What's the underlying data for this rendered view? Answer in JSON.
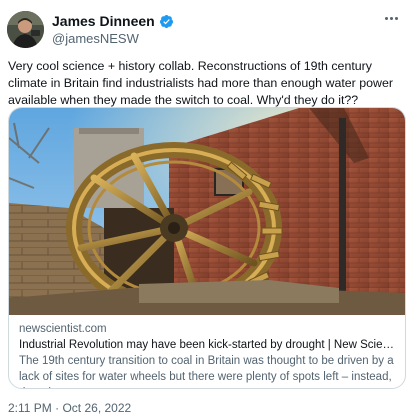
{
  "author": {
    "display_name": "James Dinneen",
    "handle": "@jamesNESW",
    "verified_icon": "verified-badge-icon",
    "accent_color": "#1d9bf0"
  },
  "tweet": {
    "text": "Very cool science + history collab. Reconstructions of 19th century climate in Britain find industrialists had more than enough water power available when they made the switch to coal. Why'd they do it??",
    "timestamp": "2:11 PM · Oct 26, 2022"
  },
  "card": {
    "image_icon": "water-wheel-photo",
    "domain": "newscientist.com",
    "title": "Industrial Revolution may have been kick-started by drought | New Scientist",
    "description": "The 19th century transition to coal in Britain was thought to be driven by a lack of sites for water wheels but there were plenty of spots left – instead, drough..."
  },
  "menu": {
    "icon": "more-options-icon"
  }
}
